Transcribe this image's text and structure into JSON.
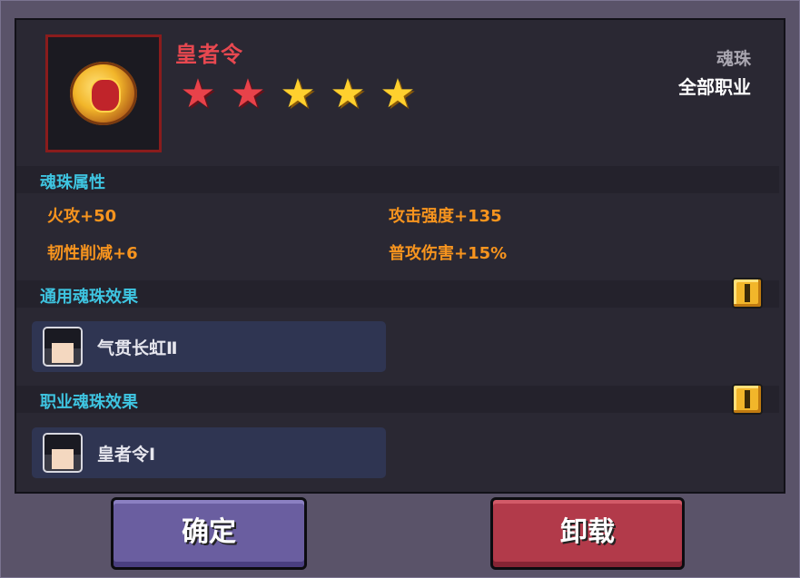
{
  "item": {
    "name": "皇者令",
    "type": "魂珠",
    "class": "全部职业",
    "stars": [
      "red",
      "red",
      "gold",
      "gold",
      "gold"
    ]
  },
  "attributes": {
    "title": "魂珠属性",
    "items": [
      "火攻+50",
      "攻击强度+135",
      "韧性削减+6",
      "普攻伤害+15%"
    ]
  },
  "common_effect": {
    "title": "通用魂珠效果",
    "label": "气贯长虹Ⅱ"
  },
  "class_effect": {
    "title": "职业魂珠效果",
    "label": "皇者令Ⅰ"
  },
  "buttons": {
    "confirm": "确定",
    "unload": "卸载"
  },
  "colors": {
    "title": "#e84850",
    "section": "#3ec4e0",
    "attribute": "#f7941e",
    "confirm_btn": "#6a5ea0",
    "unload_btn": "#b23a4a"
  }
}
